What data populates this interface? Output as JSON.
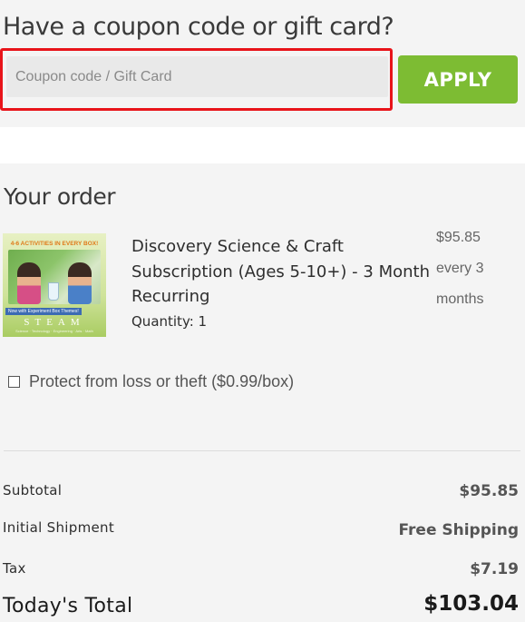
{
  "coupon": {
    "title": "Have a coupon code or gift card?",
    "placeholder": "Coupon code / Gift Card",
    "value": "",
    "apply_label": "APPLY"
  },
  "order": {
    "title": "Your order",
    "product": {
      "name": "Discovery Science & Craft Subscription (Ages 5-10+) - 3 Month Recurring",
      "quantity": "Quantity: 1",
      "price": "$95.85",
      "price_period": "every 3 months",
      "image_banner": "4-6 ACTIVITIES IN EVERY BOX!",
      "image_subbanner": "Now with Experiment Box Themes!",
      "image_steam": "STEAM",
      "image_steam_sub": "Science · Technology · Engineering · Arts · Math"
    },
    "protect_label": "Protect from loss or theft ($0.99/box)",
    "protect_checked": false
  },
  "summary": {
    "subtotal_label": "Subtotal",
    "subtotal_value": "$95.85",
    "shipping_label": "Initial Shipment",
    "shipping_value": "Free Shipping",
    "tax_label": "Tax",
    "tax_value": "$7.19",
    "total_label": "Today's Total",
    "total_value": "$103.04"
  },
  "colors": {
    "apply_button": "#7dbc33",
    "highlight_border": "#e8141a",
    "section_background": "#f4f4f4"
  }
}
